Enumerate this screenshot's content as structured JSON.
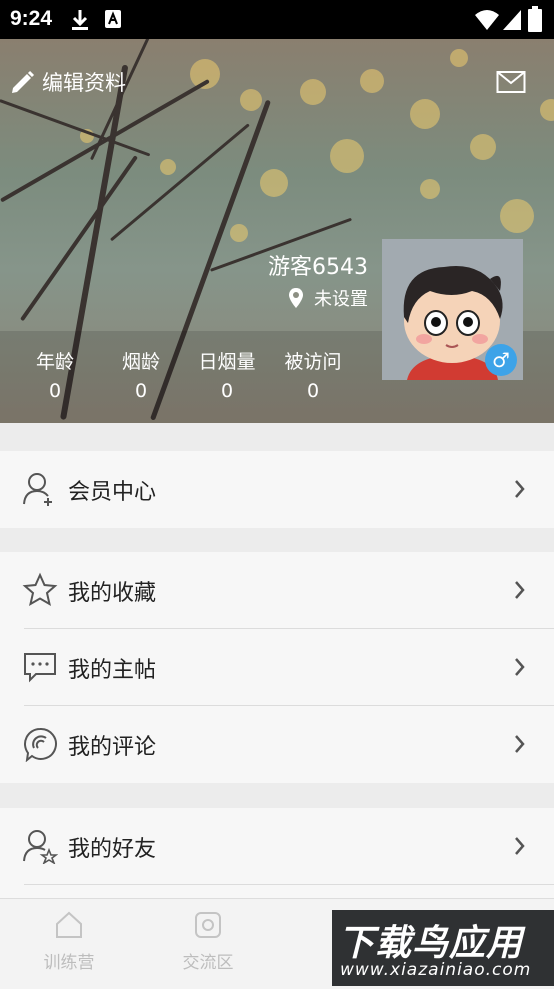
{
  "status_bar": {
    "time": "9:24"
  },
  "header": {
    "edit_label": "编辑资料",
    "nickname": "游客6543",
    "location": "未设置",
    "gender_symbol": "♂",
    "stats": [
      {
        "label": "年龄",
        "value": "0"
      },
      {
        "label": "烟龄",
        "value": "0"
      },
      {
        "label": "日烟量",
        "value": "0"
      },
      {
        "label": "被访问",
        "value": "0"
      }
    ]
  },
  "menu": {
    "member_center": "会员中心",
    "favorites": "我的收藏",
    "my_posts": "我的主帖",
    "my_comments": "我的评论",
    "my_friends": "我的好友"
  },
  "tabbar": [
    {
      "label": "训练营",
      "icon": "home-icon"
    },
    {
      "label": "交流区",
      "icon": "camera-icon"
    }
  ],
  "watermark": {
    "title": "下载鸟应用",
    "url": "www.xiazainiao.com"
  },
  "colors": {
    "gender_badge": "#3da3e8",
    "status_bar": "#000000"
  }
}
